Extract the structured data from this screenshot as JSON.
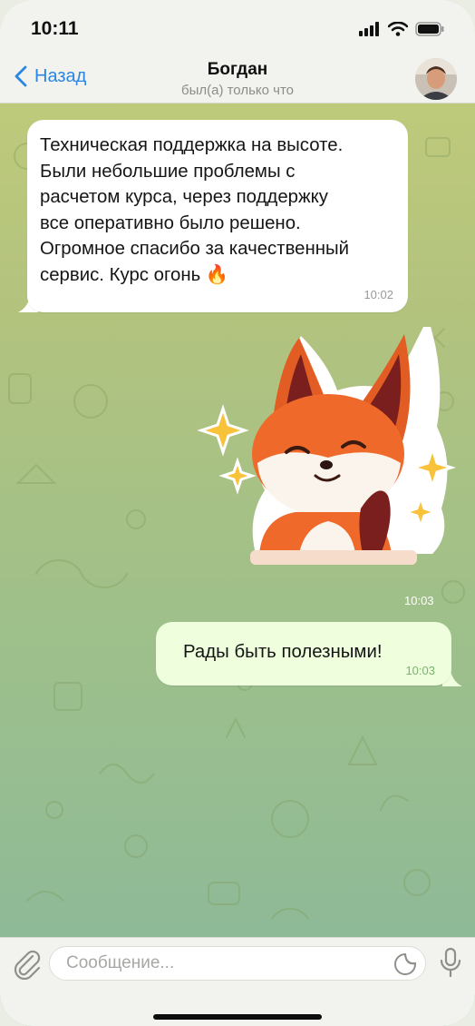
{
  "status_bar": {
    "time": "10:11"
  },
  "header": {
    "back_label": "Назад",
    "contact_name": "Богдан",
    "last_seen": "был(а) только что"
  },
  "messages": [
    {
      "direction": "incoming",
      "text": "Техническая поддержка на высоте.\nБыли небольшие проблемы с\nрасчетом курса, через поддержку\nвсе оперативно было решено.\nОгромное спасибо за качественный\nсервис. Курс огонь 🔥",
      "time": "10:02"
    },
    {
      "direction": "outgoing",
      "type": "sticker",
      "sticker": "fox-sticker",
      "time": "10:03"
    },
    {
      "direction": "outgoing",
      "text": "Рады быть полезными!",
      "time": "10:03"
    }
  ],
  "input": {
    "placeholder": "Сообщение..."
  },
  "colors": {
    "accent": "#2a86e0",
    "outgoing_bubble": "#effedd",
    "incoming_bubble": "#ffffff",
    "outgoing_time": "#7cb36e",
    "wallpaper_top": "#c3cd79",
    "wallpaper_bottom": "#8ab89b"
  },
  "icons": [
    "signal-icon",
    "wifi-icon",
    "battery-icon",
    "back-chevron-icon",
    "paperclip-icon",
    "sticker-icon",
    "microphone-icon"
  ]
}
